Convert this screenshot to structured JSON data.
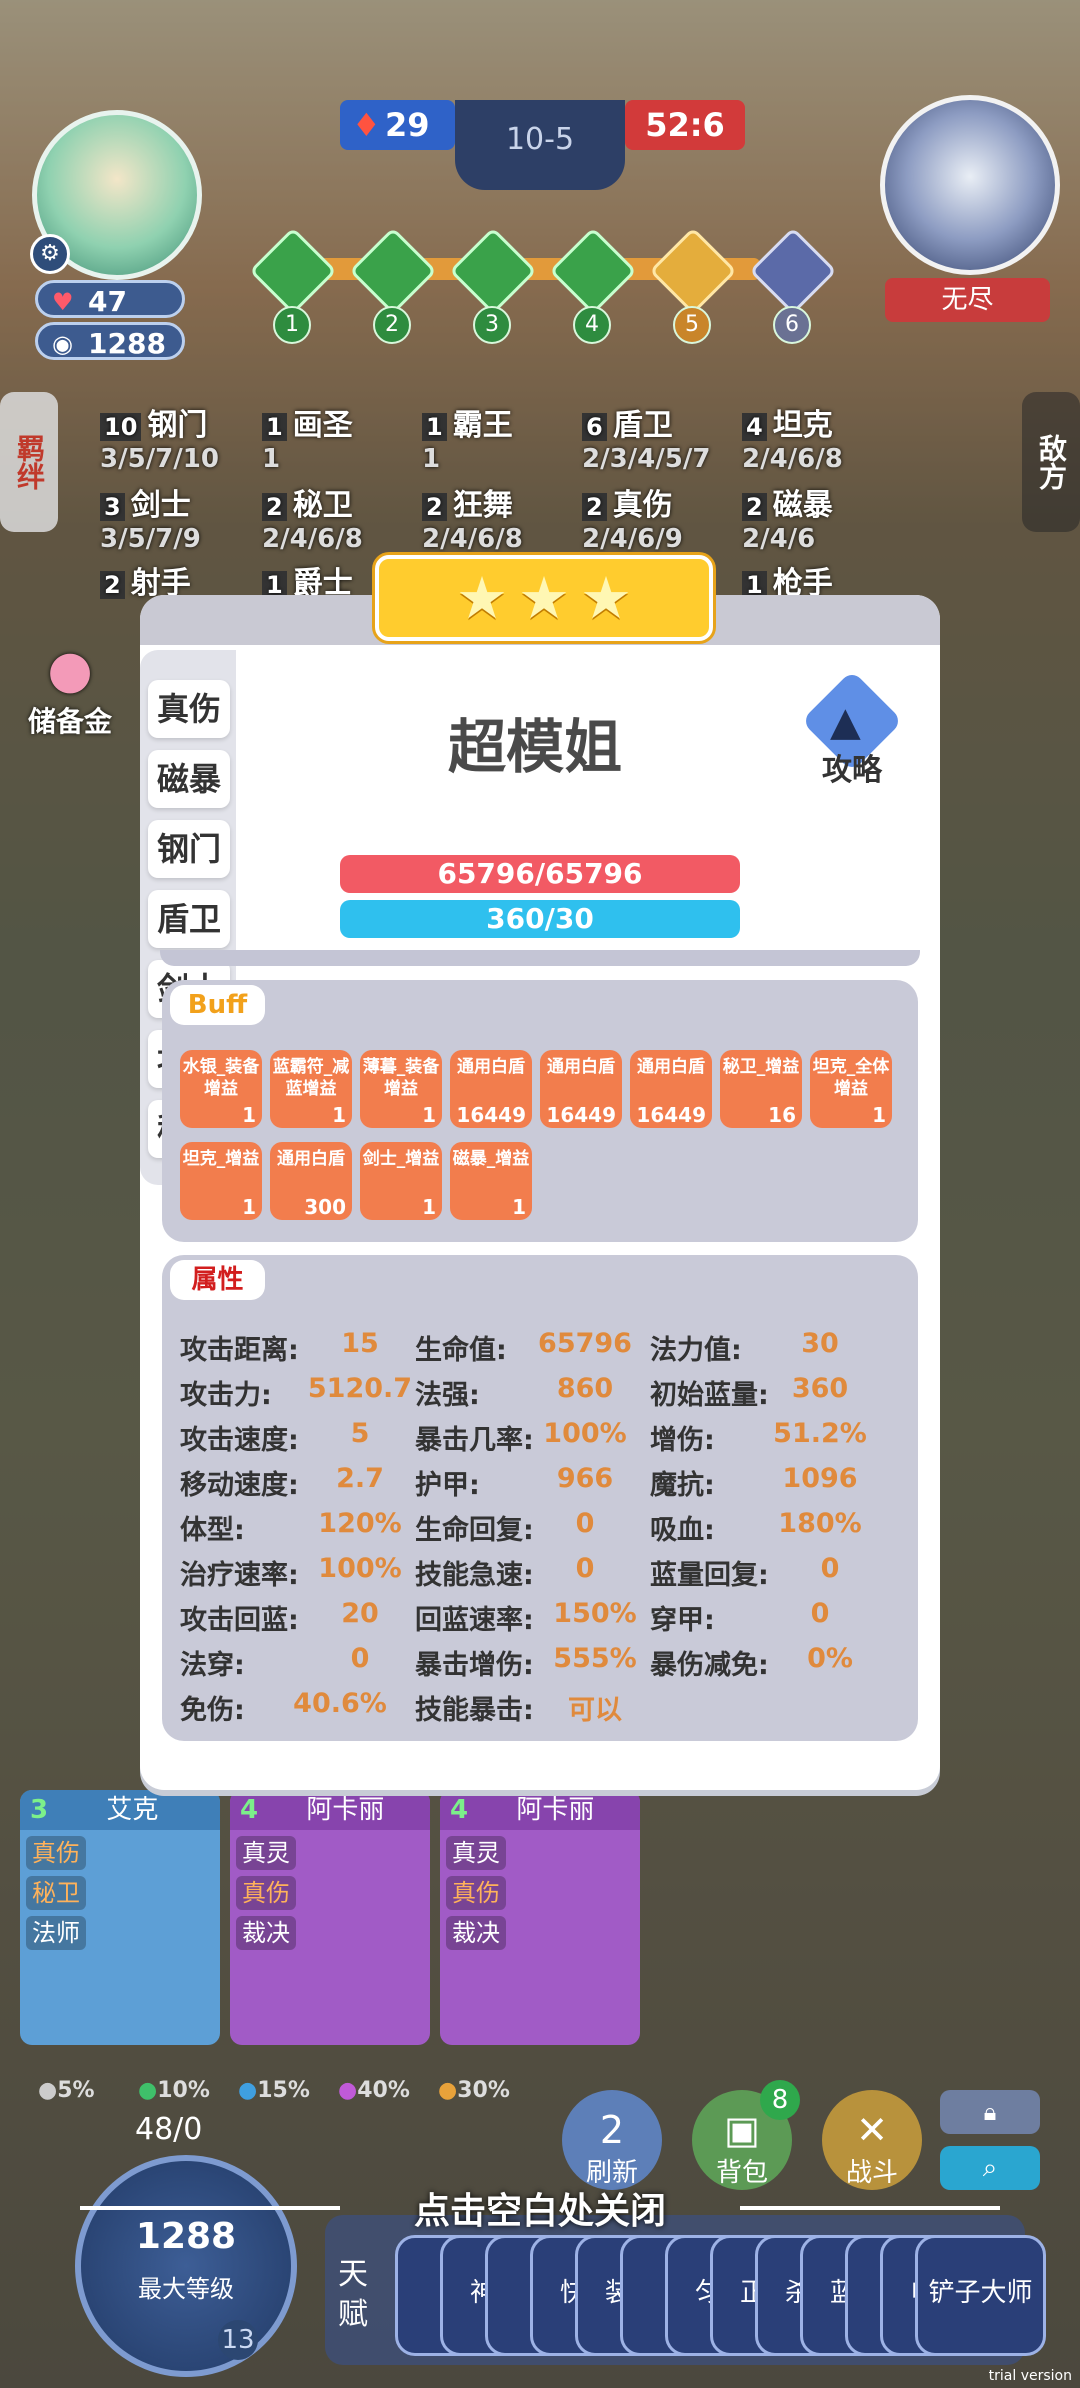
{
  "hud": {
    "hp": "47",
    "gold": "1288",
    "left_score": "29",
    "round": "10-5",
    "right_score": "52:6",
    "stages": [
      "1",
      "2",
      "3",
      "4",
      "5",
      "6"
    ],
    "enemy_label": "无尽",
    "left_tab": "羁绊",
    "right_tab": "敌方",
    "savings_label": "储备金"
  },
  "traits": [
    {
      "lv": "10",
      "name": "钢门",
      "sub": "3/5/7/10"
    },
    {
      "lv": "1",
      "name": "画圣",
      "sub": "1"
    },
    {
      "lv": "1",
      "name": "霸王",
      "sub": "1"
    },
    {
      "lv": "6",
      "name": "盾卫",
      "sub": "2/3/4/5/7"
    },
    {
      "lv": "4",
      "name": "坦克",
      "sub": "2/4/6/8"
    },
    {
      "lv": "3",
      "name": "剑士",
      "sub": "3/5/7/9"
    },
    {
      "lv": "2",
      "name": "秘卫",
      "sub": "2/4/6/8"
    },
    {
      "lv": "2",
      "name": "狂舞",
      "sub": "2/4/6/8"
    },
    {
      "lv": "2",
      "name": "真伤",
      "sub": "2/4/6/9"
    },
    {
      "lv": "2",
      "name": "磁暴",
      "sub": "2/4/6"
    },
    {
      "lv": "2",
      "name": "射手",
      "sub": ""
    },
    {
      "lv": "1",
      "name": "爵士",
      "sub": ""
    },
    {
      "lv": "1",
      "name": "枪手",
      "sub": ""
    }
  ],
  "modal": {
    "stars": 3,
    "tabs": [
      "真伤",
      "磁暴",
      "钢门",
      "盾卫",
      "剑士",
      "坦克",
      "秘卫"
    ],
    "unit_name": "超模姐",
    "strategy_label": "攻略",
    "hp_bar": "65796/65796",
    "hp_fraction": 1.0,
    "mana_bar": "360/30",
    "buff_title": "Buff",
    "buffs": [
      {
        "name": "水银_装备增益",
        "value": "1"
      },
      {
        "name": "蓝霸符_减蓝增益",
        "value": "1"
      },
      {
        "name": "薄暮_装备增益",
        "value": "1"
      },
      {
        "name": "通用白盾",
        "value": "16449"
      },
      {
        "name": "通用白盾",
        "value": "16449"
      },
      {
        "name": "通用白盾",
        "value": "16449"
      },
      {
        "name": "秘卫_增益",
        "value": "16"
      },
      {
        "name": "坦克_全体增益",
        "value": "1"
      },
      {
        "name": "坦克_增益",
        "value": "1"
      },
      {
        "name": "通用白盾",
        "value": "300"
      },
      {
        "name": "剑士_增益",
        "value": "1"
      },
      {
        "name": "磁暴_增益",
        "value": "1"
      }
    ],
    "attr_title": "属性",
    "attributes": [
      [
        {
          "k": "攻击距离:",
          "v": "15"
        },
        {
          "k": "生命值:",
          "v": "65796"
        },
        {
          "k": "法力值:",
          "v": "30"
        }
      ],
      [
        {
          "k": "攻击力:",
          "v": "5120.7"
        },
        {
          "k": "法强:",
          "v": "860"
        },
        {
          "k": "初始蓝量:",
          "v": "360"
        }
      ],
      [
        {
          "k": "攻击速度:",
          "v": "5"
        },
        {
          "k": "暴击几率:",
          "v": "100%"
        },
        {
          "k": "增伤:",
          "v": "51.2%"
        }
      ],
      [
        {
          "k": "移动速度:",
          "v": "2.7"
        },
        {
          "k": "护甲:",
          "v": "966"
        },
        {
          "k": "魔抗:",
          "v": "1096"
        }
      ],
      [
        {
          "k": "体型:",
          "v": "120%"
        },
        {
          "k": "生命回复:",
          "v": "0"
        },
        {
          "k": "吸血:",
          "v": "180%"
        }
      ],
      [
        {
          "k": "治疗速率:",
          "v": "100%"
        },
        {
          "k": "技能急速:",
          "v": "0"
        },
        {
          "k": "蓝量回复:",
          "v": "0"
        }
      ],
      [
        {
          "k": "攻击回蓝:",
          "v": "20"
        },
        {
          "k": "回蓝速率:",
          "v": "150%"
        },
        {
          "k": "穿甲:",
          "v": "0"
        }
      ],
      [
        {
          "k": "法穿:",
          "v": "0"
        },
        {
          "k": "暴击增伤:",
          "v": "555%"
        },
        {
          "k": "暴伤减免:",
          "v": "0%"
        }
      ],
      [
        {
          "k": "免伤:",
          "v": "40.6%"
        },
        {
          "k": "技能暴击:",
          "v": "可以"
        }
      ]
    ]
  },
  "shop": {
    "cards": [
      {
        "cost": "3",
        "name": "艾克",
        "tags": [
          "真伤",
          "秘卫",
          "法师"
        ],
        "color": "#5d9fd6"
      },
      {
        "cost": "4",
        "name": "阿卡丽",
        "tags": [
          "真灵",
          "真伤",
          "裁决"
        ],
        "color": "#a15bc6"
      },
      {
        "cost": "4",
        "name": "阿卡丽",
        "tags": [
          "真灵",
          "真伤",
          "裁决"
        ],
        "color": "#a15bc6"
      }
    ],
    "odds": [
      "5%",
      "10%",
      "15%",
      "40%",
      "30%"
    ],
    "odds_colors": [
      "#cccccc",
      "#3fc06a",
      "#3f9fe0",
      "#c05ad8",
      "#e8a23a"
    ],
    "xp": "48/0",
    "gold": "1288",
    "level_label": "最大等级",
    "level": "13",
    "refresh_label": "刷新",
    "refresh_count": "2",
    "bag_label": "背包",
    "bag_count": "8",
    "fight_label": "战斗",
    "talent_label": "天赋",
    "talent_chips": [
      "【",
      "神",
      "【",
      "快",
      "装",
      "【",
      "匀",
      "正",
      "杀",
      "蓝",
      "【",
      "电"
    ],
    "talent_last": "铲子大师"
  },
  "close_hint": "点击空白处关闭",
  "watermark": "trial version"
}
